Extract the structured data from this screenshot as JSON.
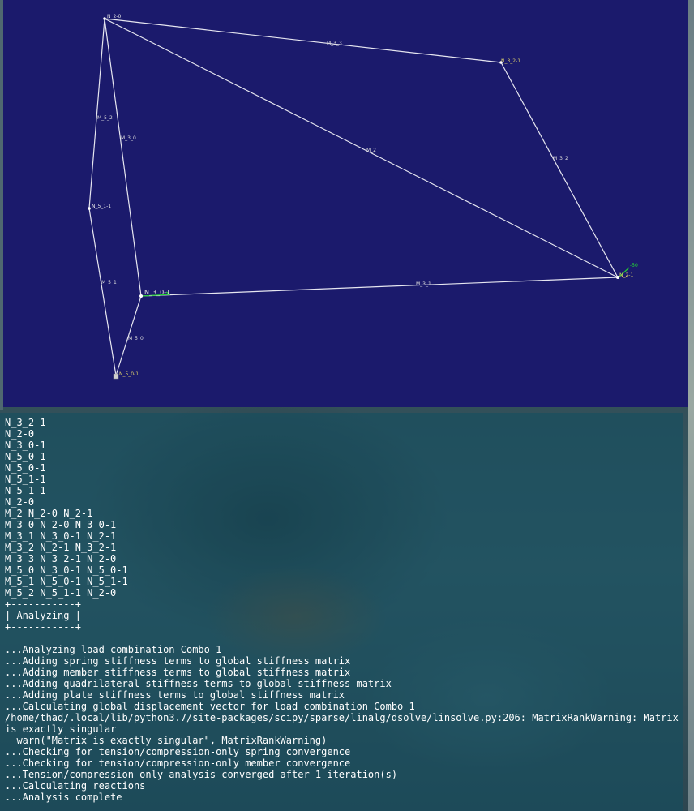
{
  "viewer": {
    "background_color": "#1b1a6c",
    "member_color": "#e6e6f0",
    "load_color": "#22cc33",
    "nodes": {
      "n2_0": "N_2-0",
      "n3_2_1": "N_3_2-1",
      "n5_1_1": "N_5_1-1",
      "n3_0_1": "N_3_0-1",
      "n2_1": "N_2-1",
      "n5_0_1": "N_5_0-1"
    },
    "members": {
      "m3_3": "M_3_3",
      "m5_2": "M_5_2",
      "m3_0": "M_3_0",
      "m2": "M_2",
      "m3_2": "M_3_2",
      "m5_1": "M_5_1",
      "m3_1": "M_3_1",
      "m5_0": "M_5_0"
    },
    "load_label": "-50"
  },
  "terminal": {
    "lines": [
      "N_3_2-1",
      "N_2-0",
      "N_3_0-1",
      "N_5_0-1",
      "N_5_0-1",
      "N_5_1-1",
      "N_5_1-1",
      "N_2-0",
      "M_2 N_2-0 N_2-1",
      "M_3_0 N_2-0 N_3_0-1",
      "M_3_1 N_3_0-1 N_2-1",
      "M_3_2 N_2-1 N_3_2-1",
      "M_3_3 N_3_2-1 N_2-0",
      "M_5_0 N_3_0-1 N_5_0-1",
      "M_5_1 N_5_0-1 N_5_1-1",
      "M_5_2 N_5_1-1 N_2-0",
      "+-----------+",
      "| Analyzing |",
      "+-----------+",
      "",
      "...Analyzing load combination Combo 1",
      "...Adding spring stiffness terms to global stiffness matrix",
      "...Adding member stiffness terms to global stiffness matrix",
      "...Adding quadrilateral stiffness terms to global stiffness matrix",
      "...Adding plate stiffness terms to global stiffness matrix",
      "...Calculating global displacement vector for load combination Combo 1",
      "/home/thad/.local/lib/python3.7/site-packages/scipy/sparse/linalg/dsolve/linsolve.py:206: MatrixRankWarning: Matrix is exactly singular",
      "  warn(\"Matrix is exactly singular\", MatrixRankWarning)",
      "...Checking for tension/compression-only spring convergence",
      "...Checking for tension/compression-only member convergence",
      "...Tension/compression-only analysis converged after 1 iteration(s)",
      "...Calculating reactions",
      "...Analysis complete"
    ]
  }
}
